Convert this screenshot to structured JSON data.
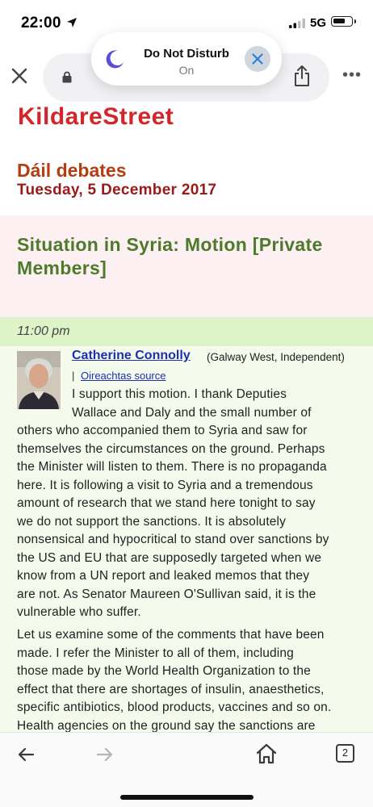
{
  "status_bar": {
    "time": "22:00",
    "network": "5G",
    "battery_level": 0.7,
    "icons": [
      "location-arrow-icon",
      "signal-icon",
      "battery-icon"
    ]
  },
  "toolbar": {
    "icons": [
      "close-icon",
      "lock-icon",
      "share-icon",
      "more-icon"
    ],
    "more_label": "•••"
  },
  "dnd_banner": {
    "title": "Do Not Disturb",
    "status": "On",
    "icons": [
      "moon-icon",
      "close-icon"
    ],
    "accent": "#5b4fd6"
  },
  "page": {
    "site_name": "KildareStreet",
    "house": "Dáil debates",
    "date": "Tuesday, 5 December 2017",
    "debate_title": "Situation in Syria: Motion [Private Members]",
    "speech_time": "11:00 pm",
    "speaker": {
      "name": "Catherine Connolly",
      "constituency": "(Galway West, Independent)",
      "separator": "|",
      "source_label": "Oireachtas source"
    },
    "paragraph1": [
      "I support this motion. I thank Deputies",
      "Wallace and Daly and the small number of",
      "others who accompanied them to Syria and saw for",
      "themselves the circumstances on the ground. Perhaps",
      "the Minister will listen to them. There is no propaganda",
      "here. It is following a visit to Syria and a tremendous",
      "amount of research that we stand here tonight to say",
      "we do not support the sanctions. It is absolutely",
      "nonsensical and hypocritical to stand over sanctions by",
      "the US and EU that are supposedly targeted when we",
      "know from a UN report and leaked memos that they",
      "are not. As Senator Maureen O'Sullivan said, it is the",
      "vulnerable who suffer."
    ],
    "paragraph2": [
      "Let us examine some of the comments that have been",
      "made. I refer the Minister to all of them, including",
      "those made by the World Health Organization to the",
      "effect that there are shortages of insulin, anaesthetics,",
      "specific antibiotics, blood products, vaccines and so on.",
      "Health agencies on the ground say the sanctions are"
    ],
    "colors": {
      "logo": "#d2262a",
      "house": "#b43e12",
      "date": "#9a1a1a",
      "title": "#4e7a2c",
      "title_bg": "#fdf0f2",
      "time_bg": "#ddf4c8",
      "speech_bg": "#f4fbec",
      "link": "#1d2eae"
    }
  },
  "bottom_bar": {
    "tab_count": "2",
    "icons": [
      "back-icon",
      "forward-icon",
      "home-icon",
      "tabs-icon"
    ]
  }
}
